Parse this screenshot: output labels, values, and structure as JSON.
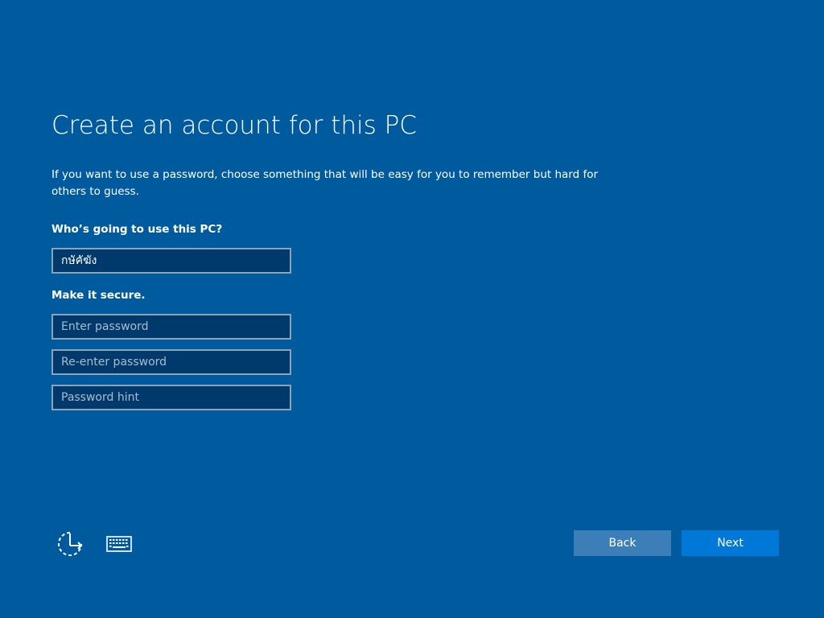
{
  "page": {
    "title": "Create an account for this PC",
    "description": "If you want to use a password, choose something that will be easy for you to remember but hard for others to guess."
  },
  "user_section": {
    "label": "Who’s going to use this PC?",
    "username_value": "กษัคัฆัง"
  },
  "secure_section": {
    "label": "Make it secure.",
    "password_placeholder": "Enter password",
    "reenter_placeholder": "Re-enter password",
    "hint_placeholder": "Password hint"
  },
  "footer": {
    "ease_of_access_icon": "ease-of-access-icon",
    "keyboard_icon": "keyboard-icon",
    "back_label": "Back",
    "next_label": "Next"
  },
  "colors": {
    "background": "#005a9e",
    "field_background": "#003a6c",
    "field_border": "#8ca3ba",
    "back_button": "#3c7fb8",
    "next_button": "#0078d7"
  }
}
